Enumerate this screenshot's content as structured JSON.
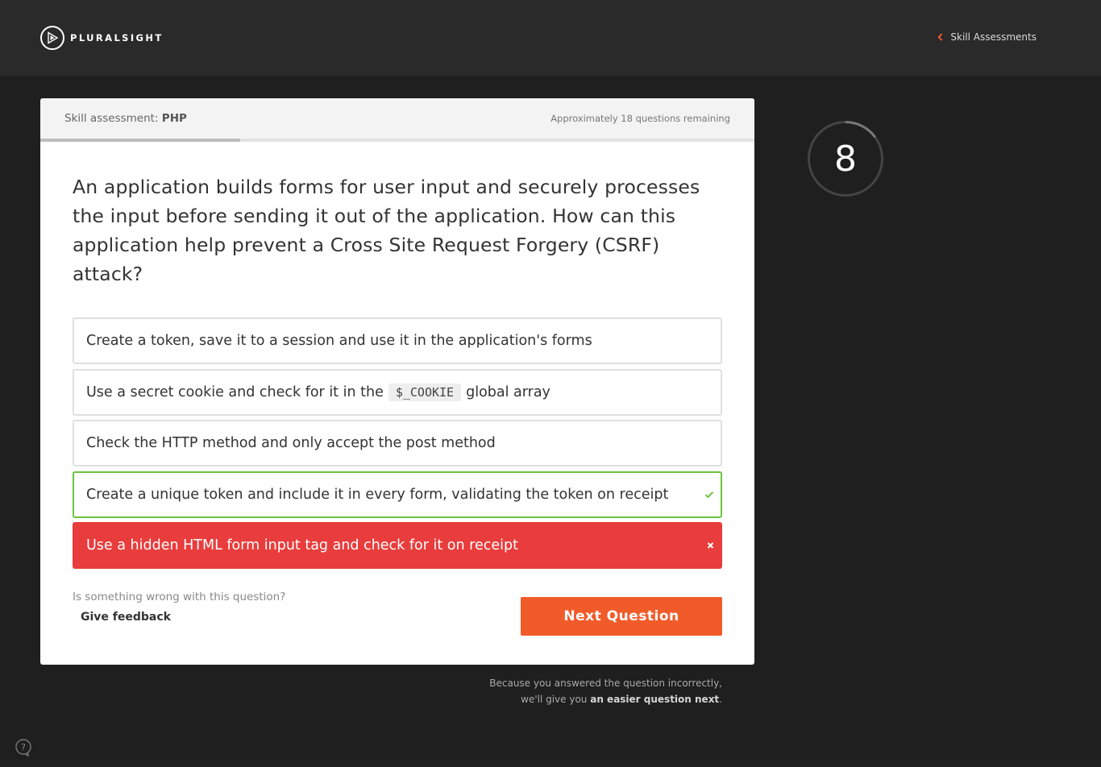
{
  "header": {
    "logo_text": "PLURALSIGHT",
    "back_link": "Skill Assessments"
  },
  "assessment": {
    "label_prefix": "Skill assessment:",
    "subject": "PHP",
    "remaining": "Approximately 18 questions remaining",
    "progress_fraction": 0.28
  },
  "question": {
    "text": "An application builds forms for user input and securely processes the input before sending it out of the application. How can this application help prevent a Cross Site Request Forgery (CSRF) attack?"
  },
  "answers": [
    {
      "text": "Create a token, save it to a session and use it in the application's forms",
      "state": "neutral"
    },
    {
      "text_before": "Use a secret cookie and check for it in the",
      "code": "$_COOKIE",
      "text_after": "global array",
      "state": "neutral"
    },
    {
      "text": "Check the HTTP method and only accept the post method",
      "state": "neutral"
    },
    {
      "text": "Create a unique token and include it in every form, validating the token on receipt",
      "state": "correct"
    },
    {
      "text": "Use a hidden HTML form input tag and check for it on receipt",
      "state": "wrong"
    }
  ],
  "feedback": {
    "question": "Is something wrong with this question?",
    "link": "Give feedback"
  },
  "next_button": "Next Question",
  "note": {
    "line1": "Because you answered the question incorrectly,",
    "line2_prefix": "we'll give you",
    "line2_bold": "an easier question next",
    "line2_suffix": "."
  },
  "timer": {
    "value": "8",
    "fraction_remaining": 0.15
  },
  "colors": {
    "accent": "#f15b2a",
    "correct": "#6cc341",
    "wrong": "#e93c3c",
    "page_bg": "#1f1f1f",
    "topbar_bg": "#2a2a2a"
  },
  "icons": [
    "pluralsight-logo-icon",
    "chevron-left-icon",
    "check-icon",
    "close-icon",
    "help-icon"
  ]
}
